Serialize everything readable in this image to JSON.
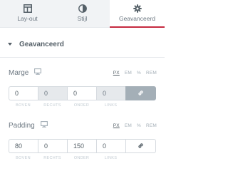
{
  "tabs": [
    {
      "label": "Lay-out",
      "icon": "layout-icon"
    },
    {
      "label": "Stijl",
      "icon": "style-icon"
    },
    {
      "label": "Geavanceerd",
      "icon": "gear-icon"
    }
  ],
  "section": {
    "title": "Geavanceerd"
  },
  "margin": {
    "title": "Marge",
    "units": [
      "PX",
      "EM",
      "%",
      "REM"
    ],
    "selected_unit": "PX",
    "values": {
      "top": "0",
      "right": "0",
      "bottom": "0",
      "left": "0"
    },
    "labels": {
      "top": "BOVEN",
      "right": "RECHTS",
      "bottom": "ONDER",
      "left": "LINKS"
    }
  },
  "padding": {
    "title": "Padding",
    "units": [
      "PX",
      "EM",
      "%",
      "REM"
    ],
    "selected_unit": "PX",
    "values": {
      "top": "80",
      "right": "0",
      "bottom": "150",
      "left": "0"
    },
    "labels": {
      "top": "BOVEN",
      "right": "RECHTS",
      "bottom": "ONDER",
      "left": "LINKS"
    }
  },
  "colors": {
    "accent": "#c5293f",
    "text": "#6d7882",
    "muted": "#a4afb7"
  }
}
